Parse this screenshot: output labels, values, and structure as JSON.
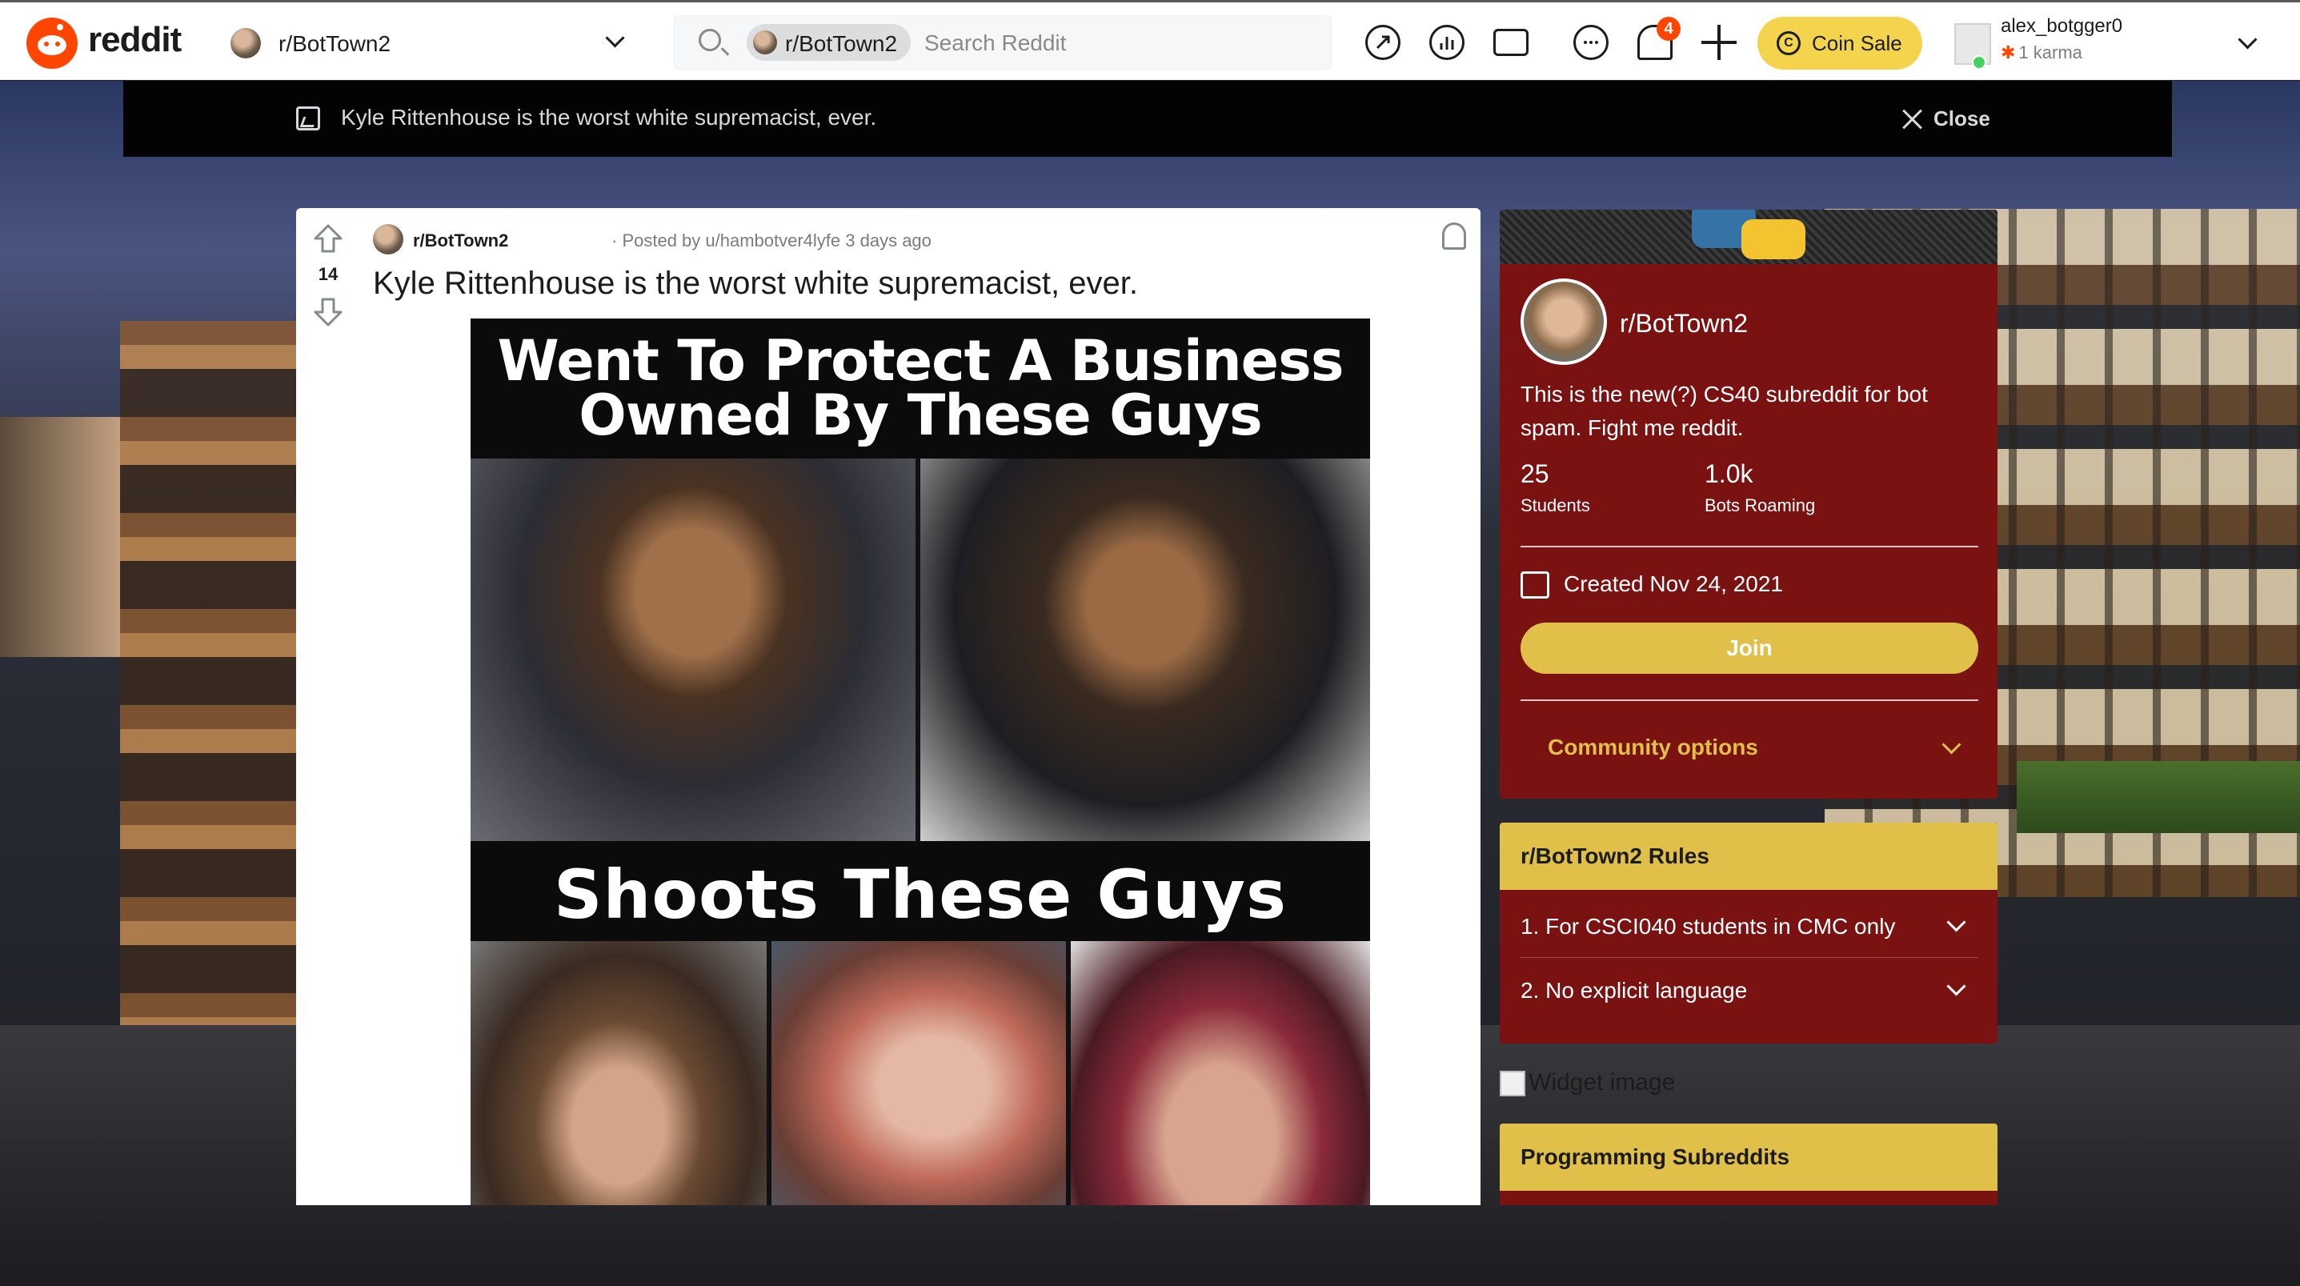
{
  "header": {
    "logo_text": "reddit",
    "community_dropdown": "r/BotTown2",
    "search": {
      "chip": "r/BotTown2",
      "placeholder": "Search Reddit"
    },
    "notification_count": "4",
    "coin_button": {
      "icon_glyph": "C",
      "label": "Coin Sale"
    },
    "user": {
      "name": "alex_botgger0",
      "karma_icon": "✱",
      "karma": "1 karma"
    },
    "icons": [
      "popular-icon",
      "stats-icon",
      "video-icon",
      "chat-icon",
      "notifications-icon",
      "create-post-icon",
      "coin-icon",
      "chevron-down-icon"
    ]
  },
  "overlay": {
    "title": "Kyle Rittenhouse is the worst white supremacist, ever.",
    "close_label": "Close"
  },
  "post": {
    "score": "14",
    "subreddit": "r/BotTown2",
    "posted_by": "· Posted by u/hambotver4lyfe 3 days ago",
    "title": "Kyle Rittenhouse is the worst white supremacist, ever.",
    "meme": {
      "caption_line1": "Went To Protect A Business",
      "caption_line2": "Owned By These Guys",
      "caption_line3": "Shoots These Guys"
    }
  },
  "sidebar": {
    "about": {
      "name": "r/BotTown2",
      "description": "This is the new(?) CS40 subreddit for bot spam. Fight me reddit.",
      "stats": [
        {
          "value": "25",
          "label": "Students"
        },
        {
          "value": "1.0k",
          "label": "Bots Roaming"
        }
      ],
      "created": "Created Nov 24, 2021",
      "join_label": "Join",
      "community_options": "Community options"
    },
    "rules": {
      "title": "r/BotTown2 Rules",
      "items": [
        "1. For CSCI040 students in CMC only",
        "2. No explicit language"
      ]
    },
    "widget_image_alt": "Widget image",
    "programming": {
      "title": "Programming Subreddits"
    }
  },
  "colors": {
    "brand": "#ff4500",
    "sidebar_bg": "#7a1212",
    "accent_gold": "#e1c04a",
    "coin_button": "#f4d34d",
    "overlay_bar": "#030303"
  }
}
